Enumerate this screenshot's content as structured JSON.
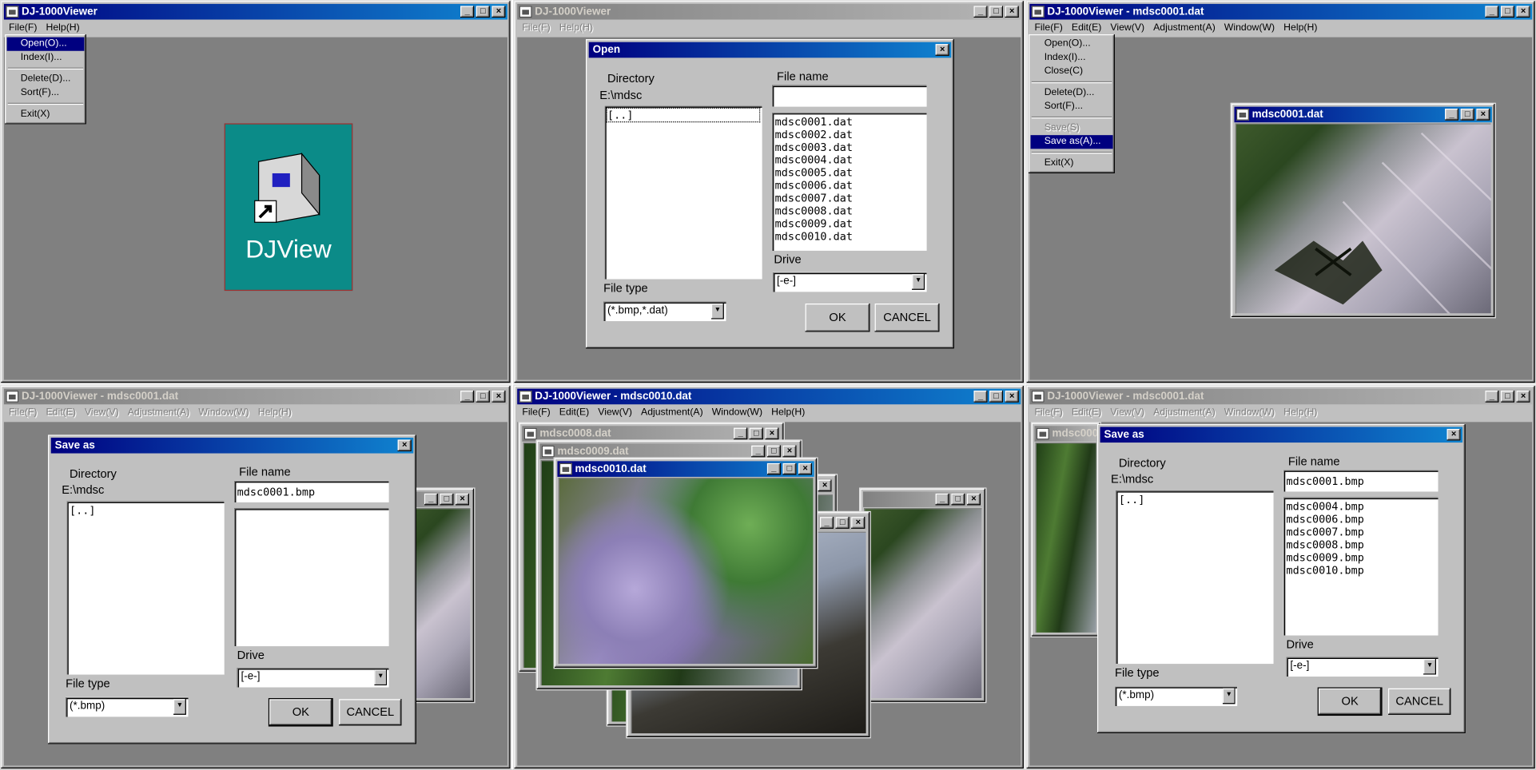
{
  "colors": {
    "titlebar_active": "#000080",
    "titlebar_inactive": "#808080",
    "window_face": "#c0c0c0",
    "workspace": "#808080",
    "desktop_icon_bg": "#0b8b88"
  },
  "panel1": {
    "title": "DJ-1000Viewer",
    "menu": [
      "File(F)",
      "Help(H)"
    ],
    "file_menu": [
      "Open(O)...",
      "Index(I)...",
      "Delete(D)...",
      "Sort(F)...",
      "Exit(X)"
    ],
    "icon_label": "DJView"
  },
  "panel2": {
    "title": "DJ-1000Viewer",
    "menu": [
      "File(F)",
      "Help(H)"
    ],
    "dialog": {
      "title": "Open",
      "directory_label": "Directory",
      "directory_path": "E:\\mdsc",
      "dir_items": [
        "[..]"
      ],
      "filename_label": "File name",
      "filename_value": "",
      "files": [
        "mdsc0001.dat",
        "mdsc0002.dat",
        "mdsc0003.dat",
        "mdsc0004.dat",
        "mdsc0005.dat",
        "mdsc0006.dat",
        "mdsc0007.dat",
        "mdsc0008.dat",
        "mdsc0009.dat",
        "mdsc0010.dat"
      ],
      "drive_label": "Drive",
      "drive_value": "[-e-]",
      "filetype_label": "File type",
      "filetype_value": "(*.bmp,*.dat)",
      "ok": "OK",
      "cancel": "CANCEL"
    }
  },
  "panel3": {
    "title": "DJ-1000Viewer - mdsc0001.dat",
    "menu": [
      "File(F)",
      "Edit(E)",
      "View(V)",
      "Adjustment(A)",
      "Window(W)",
      "Help(H)"
    ],
    "file_menu": [
      "Open(O)...",
      "Index(I)...",
      "Close(C)",
      "Delete(D)...",
      "Sort(F)...",
      "Save(S)",
      "Save as(A)...",
      "Exit(X)"
    ],
    "image_window": "mdsc0001.dat"
  },
  "panel4": {
    "title": "DJ-1000Viewer - mdsc0001.dat",
    "menu": [
      "File(F)",
      "Edit(E)",
      "View(V)",
      "Adjustment(A)",
      "Window(W)",
      "Help(H)"
    ],
    "dialog": {
      "title": "Save as",
      "directory_label": "Directory",
      "directory_path": "E:\\mdsc",
      "dir_items": [
        "[..]"
      ],
      "filename_label": "File name",
      "filename_value": "mdsc0001.bmp",
      "files": [],
      "drive_label": "Drive",
      "drive_value": "[-e-]",
      "filetype_label": "File type",
      "filetype_value": "(*.bmp)",
      "ok": "OK",
      "cancel": "CANCEL"
    }
  },
  "panel5": {
    "title": "DJ-1000Viewer - mdsc0010.dat",
    "menu": [
      "File(F)",
      "Edit(E)",
      "View(V)",
      "Adjustment(A)",
      "Window(W)",
      "Help(H)"
    ],
    "windows": [
      "mdsc0008.dat",
      "mdsc0009.dat",
      "mdsc0010.dat"
    ]
  },
  "panel6": {
    "title": "DJ-1000Viewer - mdsc0001.dat",
    "menu": [
      "File(F)",
      "Edit(E)",
      "View(V)",
      "Adjustment(A)",
      "Window(W)",
      "Help(H)"
    ],
    "bg_window": "mdsc0001",
    "dialog": {
      "title": "Save as",
      "directory_label": "Directory",
      "directory_path": "E:\\mdsc",
      "dir_items": [
        "[..]"
      ],
      "filename_label": "File name",
      "filename_value": "mdsc0001.bmp",
      "files": [
        "mdsc0004.bmp",
        "mdsc0006.bmp",
        "mdsc0007.bmp",
        "mdsc0008.bmp",
        "mdsc0009.bmp",
        "mdsc0010.bmp"
      ],
      "drive_label": "Drive",
      "drive_value": "[-e-]",
      "filetype_label": "File type",
      "filetype_value": "(*.bmp)",
      "ok": "OK",
      "cancel": "CANCEL"
    }
  }
}
